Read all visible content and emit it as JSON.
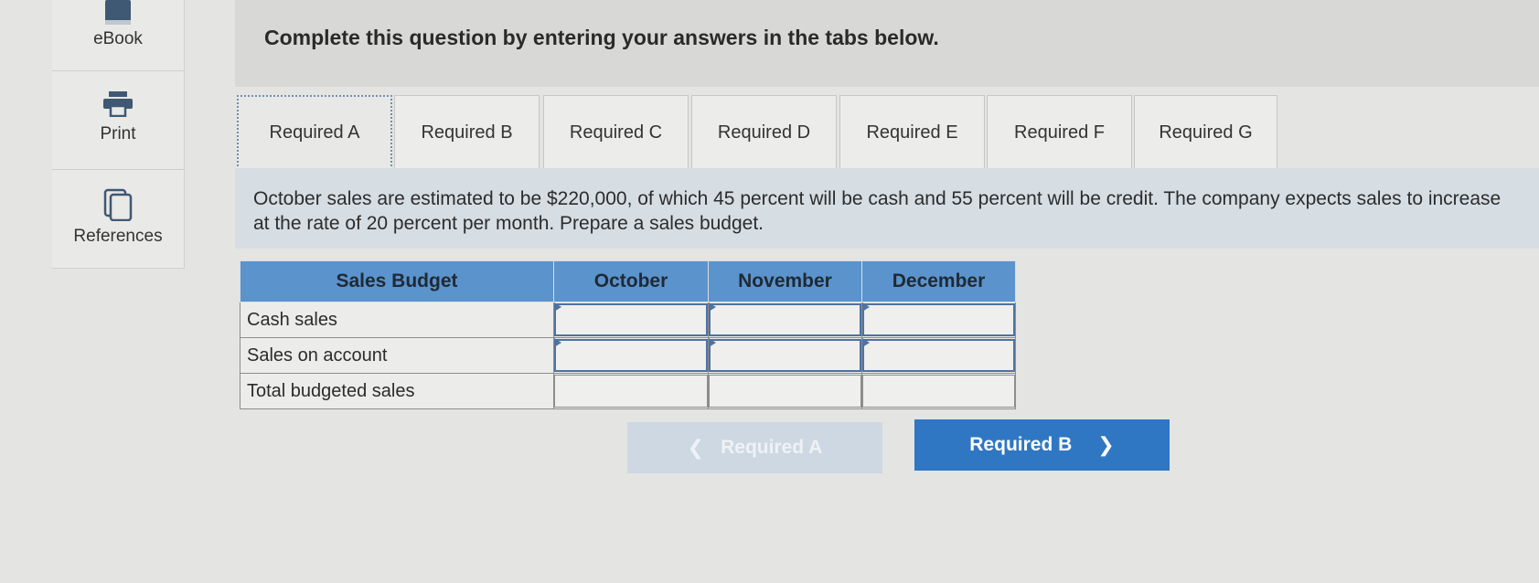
{
  "sidebar": {
    "items": [
      {
        "label": "eBook",
        "icon": "book-icon"
      },
      {
        "label": "Print",
        "icon": "printer-icon"
      },
      {
        "label": "References",
        "icon": "copy-documents-icon"
      }
    ]
  },
  "header": {
    "title": "Complete this question by entering your answers in the tabs below."
  },
  "tabs": [
    {
      "label": "Required A",
      "active": true
    },
    {
      "label": "Required B",
      "active": false
    },
    {
      "label": "Required C",
      "active": false
    },
    {
      "label": "Required D",
      "active": false
    },
    {
      "label": "Required E",
      "active": false
    },
    {
      "label": "Required F",
      "active": false
    },
    {
      "label": "Required G",
      "active": false
    }
  ],
  "instructions": "October sales are estimated to be $220,000, of which 45 percent will be cash and 55 percent will be credit. The company expects sales to increase at the rate of 20 percent per month. Prepare a sales budget.",
  "table": {
    "headers": [
      "Sales Budget",
      "October",
      "November",
      "December"
    ],
    "rows": [
      {
        "label": "Cash sales",
        "values": [
          "",
          "",
          ""
        ]
      },
      {
        "label": "Sales on account",
        "values": [
          "",
          "",
          ""
        ]
      },
      {
        "label": "Total budgeted sales",
        "values": [
          "",
          "",
          ""
        ]
      }
    ]
  },
  "nav": {
    "prev_label": "Required A",
    "next_label": "Required B"
  },
  "colors": {
    "accent": "#2f77c3",
    "table_header": "#5b93cc",
    "background": "#e4e4e2"
  }
}
